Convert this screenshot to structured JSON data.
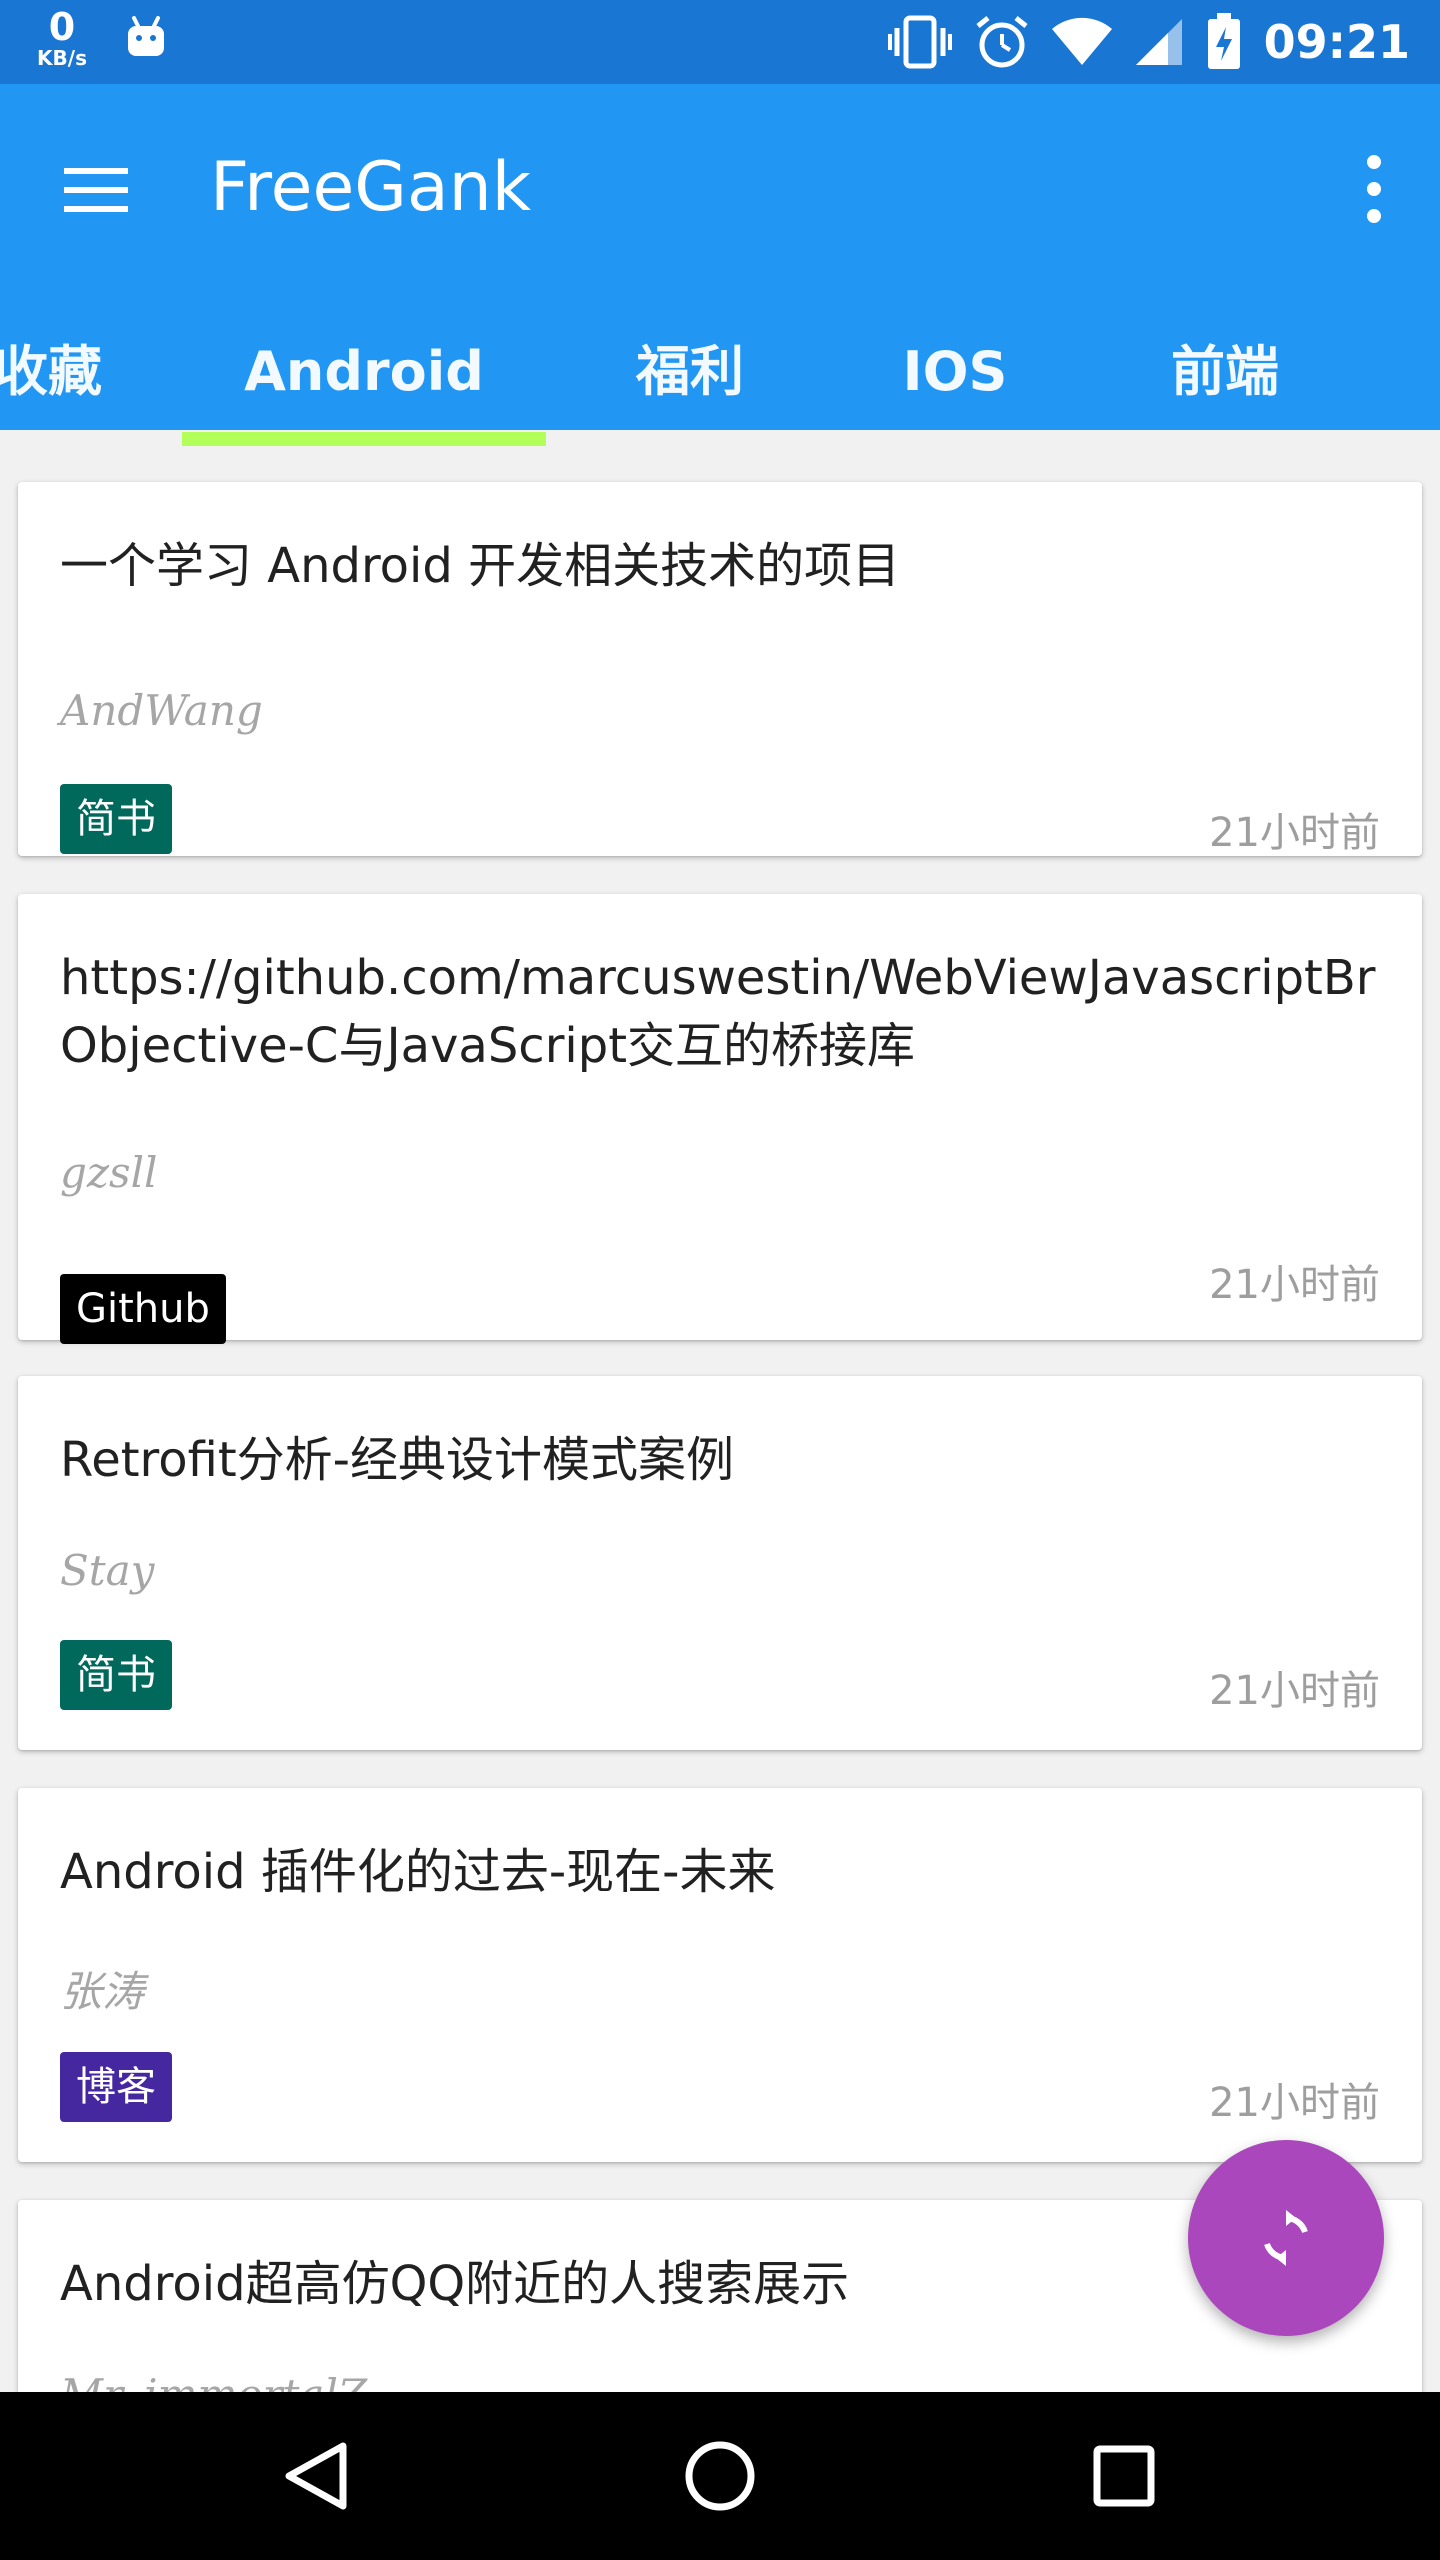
{
  "status_bar": {
    "net_speed_value": "0",
    "net_speed_unit": "KB/s",
    "time": "09:21",
    "icons": [
      "android-icon",
      "vibrate-icon",
      "alarm-icon",
      "wifi-icon",
      "signal-icon",
      "battery-icon"
    ]
  },
  "app_bar": {
    "title": "FreeGank",
    "menu_icon": "hamburger-menu-icon",
    "more_icon": "more-vert-icon",
    "color": "#2196f3"
  },
  "tabs": [
    {
      "label": "收藏"
    },
    {
      "label": "Android",
      "selected": true
    },
    {
      "label": "福利"
    },
    {
      "label": "IOS"
    },
    {
      "label": "前端"
    }
  ],
  "tab_indicator_color": "#b2ff59",
  "articles": [
    {
      "title": "一个学习 Android 开发相关技术的项目",
      "author": "AndWang",
      "tag": "简书",
      "tag_color": "#00695c",
      "time": "21小时前"
    },
    {
      "title": "https://github.com/marcuswestin/WebViewJavascriptBridge Objective-C与JavaScript交互的桥接库",
      "author": "gzsll",
      "tag": "Github",
      "tag_color": "#000000",
      "time": "21小时前"
    },
    {
      "title": "Retrofit分析-经典设计模式案例",
      "author": "Stay",
      "tag": "简书",
      "tag_color": "#00695c",
      "time": "21小时前"
    },
    {
      "title": "Android 插件化的过去-现在-未来",
      "author": "张涛",
      "tag": "博客",
      "tag_color": "#4527a0",
      "time": "21小时前"
    },
    {
      "title": "Android超高仿QQ附近的人搜索展示",
      "author": "Mr_immortalZ",
      "tag": "",
      "tag_color": "",
      "time": ""
    }
  ],
  "fab": {
    "icon": "refresh-icon",
    "color": "#ab47bc"
  },
  "nav_bar": {
    "icons": [
      "back-icon",
      "home-icon",
      "recents-icon"
    ]
  }
}
